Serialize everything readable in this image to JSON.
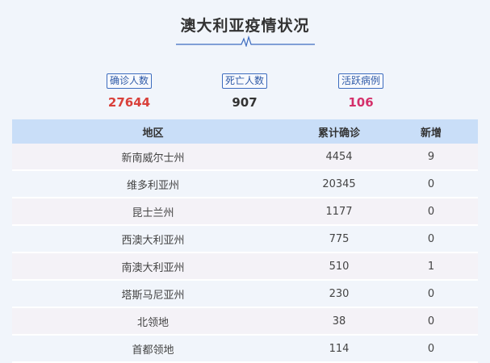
{
  "title": "澳大利亚疫情状况",
  "stats": [
    {
      "label": "确诊人数",
      "value": "27644",
      "color": "#d9403a"
    },
    {
      "label": "死亡人数",
      "value": "907",
      "color": "#333333"
    },
    {
      "label": "活跃病例",
      "value": "106",
      "color": "#d4306a"
    }
  ],
  "table": {
    "headers": [
      "地区",
      "累计确诊",
      "新增"
    ],
    "rows": [
      {
        "region": "新南威尔士州",
        "total": "4454",
        "new": "9"
      },
      {
        "region": "维多利亚州",
        "total": "20345",
        "new": "0"
      },
      {
        "region": "昆士兰州",
        "total": "1177",
        "new": "0"
      },
      {
        "region": "西澳大利亚州",
        "total": "775",
        "new": "0"
      },
      {
        "region": "南澳大利亚州",
        "total": "510",
        "new": "1"
      },
      {
        "region": "塔斯马尼亚州",
        "total": "230",
        "new": "0"
      },
      {
        "region": "北领地",
        "total": "38",
        "new": "0"
      },
      {
        "region": "首都领地",
        "total": "114",
        "new": "0"
      }
    ]
  }
}
